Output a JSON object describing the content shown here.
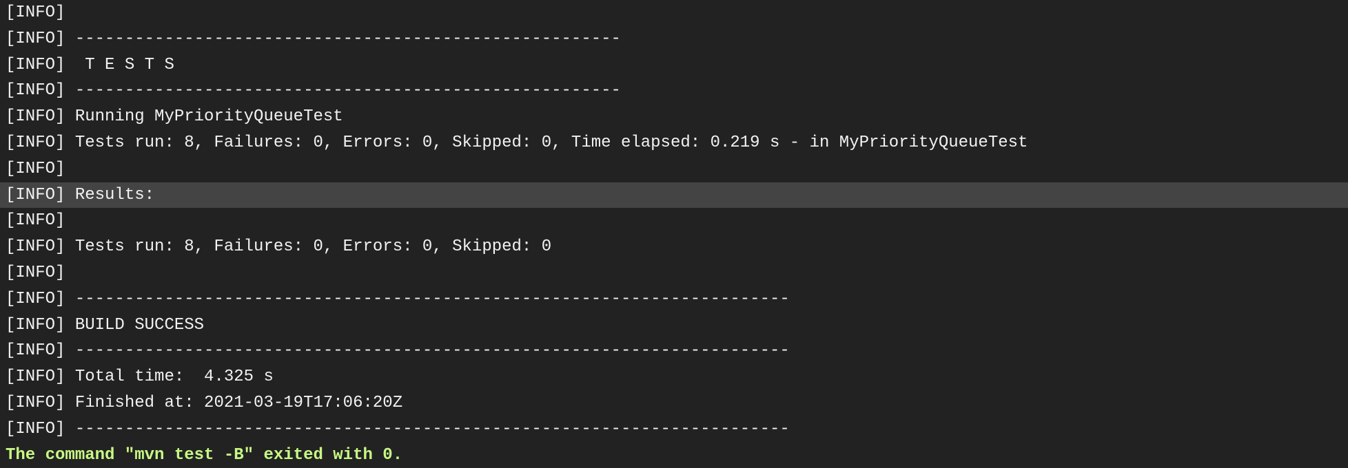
{
  "terminal": {
    "colors": {
      "background": "#222222",
      "text": "#f2f2f2",
      "highlight": "#444444",
      "status": "#c8f884"
    },
    "highlighted_line_index": 7,
    "lines": [
      "[INFO]",
      "[INFO] -------------------------------------------------------",
      "[INFO]  T E S T S",
      "[INFO] -------------------------------------------------------",
      "[INFO] Running MyPriorityQueueTest",
      "[INFO] Tests run: 8, Failures: 0, Errors: 0, Skipped: 0, Time elapsed: 0.219 s - in MyPriorityQueueTest",
      "[INFO]",
      "[INFO] Results:",
      "[INFO]",
      "[INFO] Tests run: 8, Failures: 0, Errors: 0, Skipped: 0",
      "[INFO]",
      "[INFO] ------------------------------------------------------------------------",
      "[INFO] BUILD SUCCESS",
      "[INFO] ------------------------------------------------------------------------",
      "[INFO] Total time:  4.325 s",
      "[INFO] Finished at: 2021-03-19T17:06:20Z",
      "[INFO] ------------------------------------------------------------------------"
    ],
    "exit_message": "The command \"mvn test -B\" exited with 0."
  }
}
